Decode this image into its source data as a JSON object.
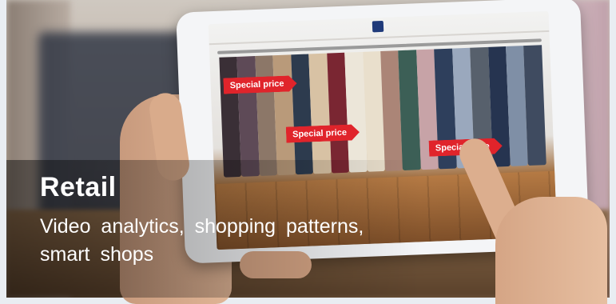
{
  "heading": {
    "title": "Retail",
    "subtitle_line1": "Video analytics, shopping patterns,",
    "subtitle_line2": "smart shops"
  },
  "tablet_screen": {
    "tags": [
      "Special price",
      "Special price",
      "Special price"
    ]
  },
  "colors": {
    "tag_red": "#e0242b",
    "caption_text": "#ffffff"
  }
}
